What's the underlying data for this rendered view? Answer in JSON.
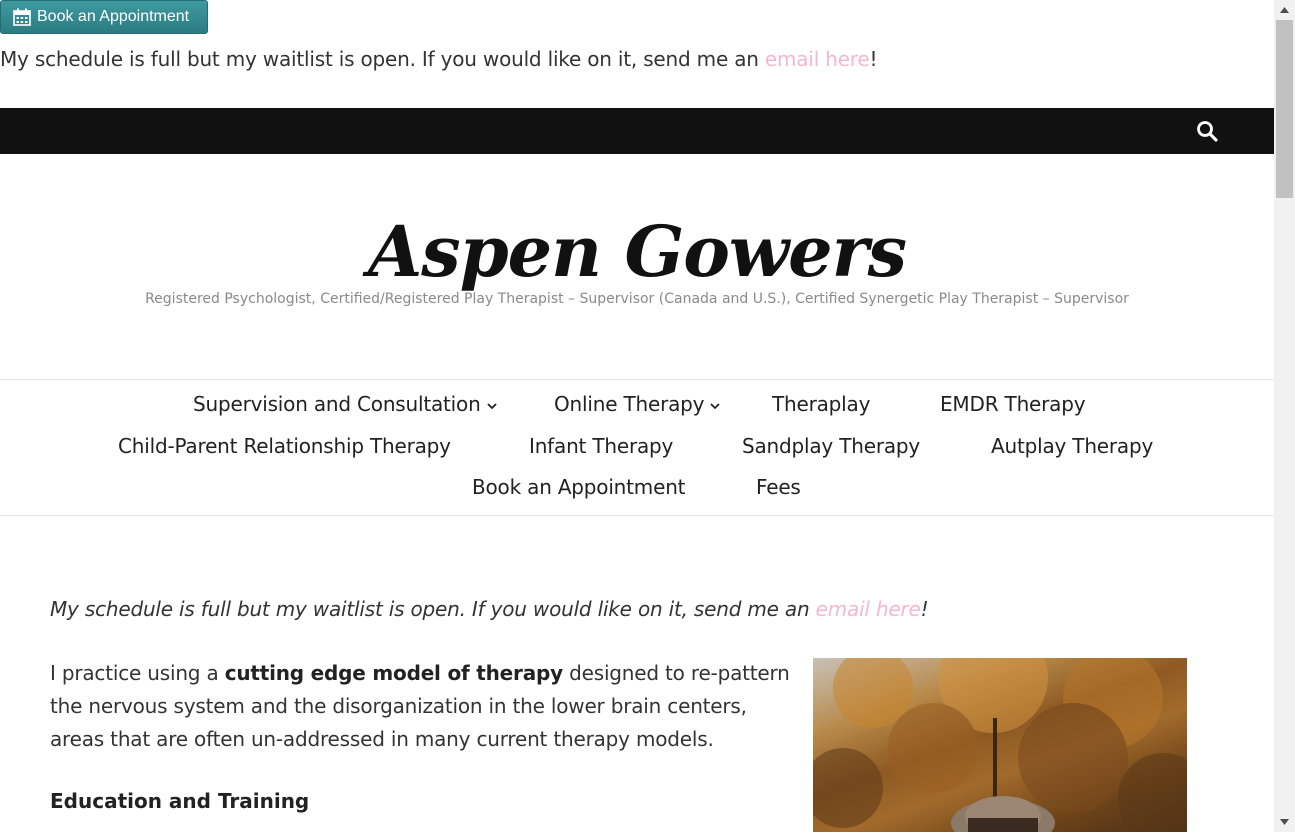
{
  "header": {
    "book_button_label": "Book an Appointment",
    "notice_text": "My schedule is full but my waitlist is open. If you would like on it, send me an ",
    "notice_link": "email here",
    "notice_end": "!"
  },
  "site": {
    "title": "Aspen Gowers",
    "tagline": "Registered Psychologist, Certified/Registered Play Therapist – Supervisor (Canada and U.S.), Certified Synergetic Play Therapist – Supervisor"
  },
  "nav": {
    "items": [
      {
        "label": "Supervision and Consultation",
        "has_dropdown": true
      },
      {
        "label": "Online Therapy",
        "has_dropdown": true
      },
      {
        "label": "Theraplay"
      },
      {
        "label": "EMDR Therapy"
      },
      {
        "label": "Child-Parent Relationship Therapy"
      },
      {
        "label": "Infant Therapy"
      },
      {
        "label": "Sandplay Therapy"
      },
      {
        "label": "Autplay Therapy"
      },
      {
        "label": "Book an Appointment"
      },
      {
        "label": "Fees"
      }
    ]
  },
  "main": {
    "intro_text": "My schedule is full but my waitlist is open. If you would like on it, send me an ",
    "intro_link": "email here",
    "intro_end": "!",
    "para_before": "I practice using a ",
    "para_bold": "cutting edge model of therapy",
    "para_after": " designed to re-pattern the nervous system and the disorganization in the lower brain centers, areas that are often un-addressed in many current therapy models.",
    "education_heading": "Education and Training"
  },
  "colors": {
    "link": "#f3b8cf",
    "button": "#2f8389",
    "topbar": "#111111"
  }
}
